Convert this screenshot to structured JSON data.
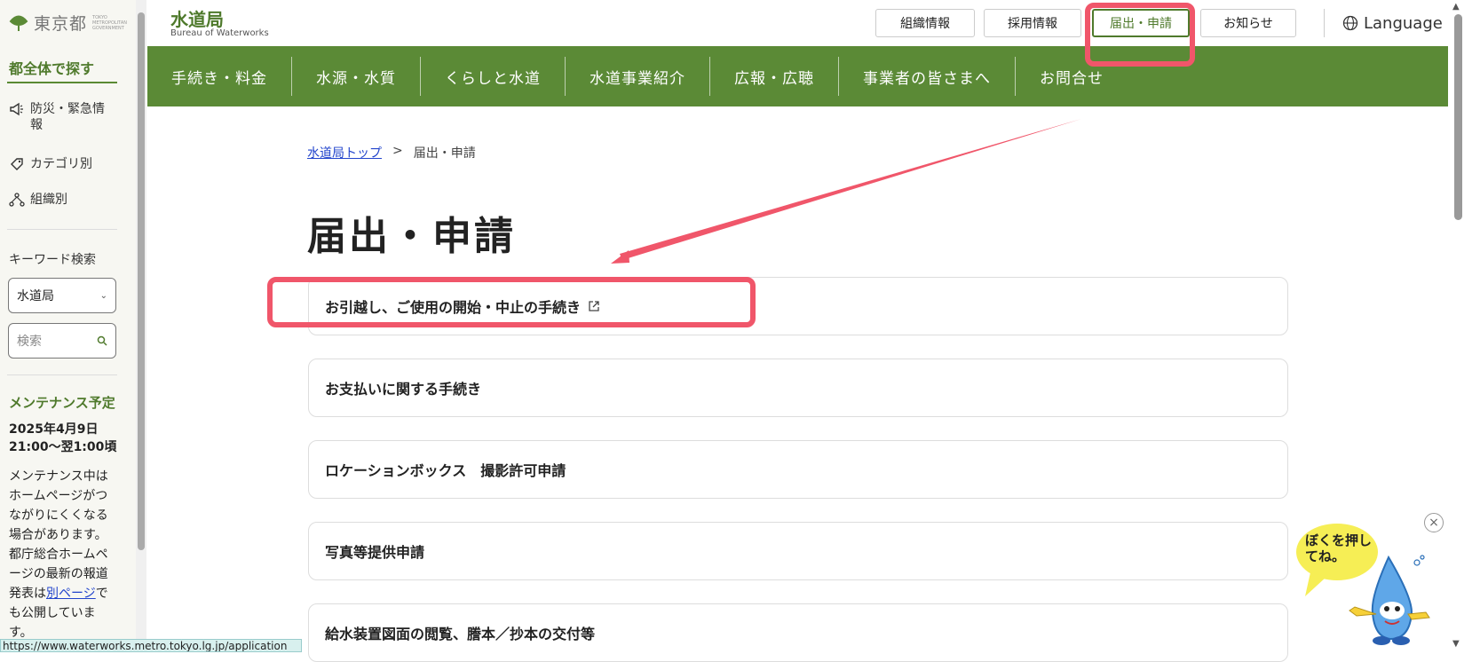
{
  "sidebar": {
    "logo_text": "東京都",
    "logo_en": "TOKYO METROPOLITAN GOVERNMENT",
    "section_title": "都全体で探す",
    "items": [
      {
        "label": "防災・緊急情報",
        "icon": "megaphone-icon"
      },
      {
        "label": "カテゴリ別",
        "icon": "tag-icon"
      },
      {
        "label": "組織別",
        "icon": "org-chart-icon"
      }
    ],
    "keyword_label": "キーワード検索",
    "select_value": "水道局",
    "search_placeholder": "検索",
    "maintenance_title": "メンテナンス予定",
    "maintenance_date": "2025年4月9日 21:00〜翌1:00頃",
    "maintenance_body_1": "メンテナンス中はホームページがつながりにくくなる場合があります。都庁総合ホームページの最新の報道発表は",
    "maintenance_link": "別ページ",
    "maintenance_body_2": "でも公開しています。"
  },
  "header": {
    "title": "水道局",
    "subtitle": "Bureau of Waterworks",
    "buttons": [
      "組織情報",
      "採用情報",
      "届出・申請",
      "お知らせ"
    ],
    "language": "Language"
  },
  "nav": {
    "items": [
      "手続き・料金",
      "水源・水質",
      "くらしと水道",
      "水道事業紹介",
      "広報・広聴",
      "事業者の皆さまへ",
      "お問合せ"
    ]
  },
  "breadcrumb": {
    "home": "水道局トップ",
    "separator": ">",
    "current": "届出・申請"
  },
  "main": {
    "title": "届出・申請",
    "cards": [
      "お引越し、ご使用の開始・中止の手続き",
      "お支払いに関する手続き",
      "ロケーションボックス　撮影許可申請",
      "写真等提供申請",
      "給水装置図面の閲覧、謄本／抄本の交付等"
    ]
  },
  "mascot": {
    "bubble_text": "ぼくを押してね。",
    "close": "×"
  },
  "status_url": "https://www.waterworks.metro.tokyo.lg.jp/application",
  "colors": {
    "brand_green": "#5b8a36",
    "annotation_red": "#f0566a",
    "link_blue": "#2244cc"
  }
}
